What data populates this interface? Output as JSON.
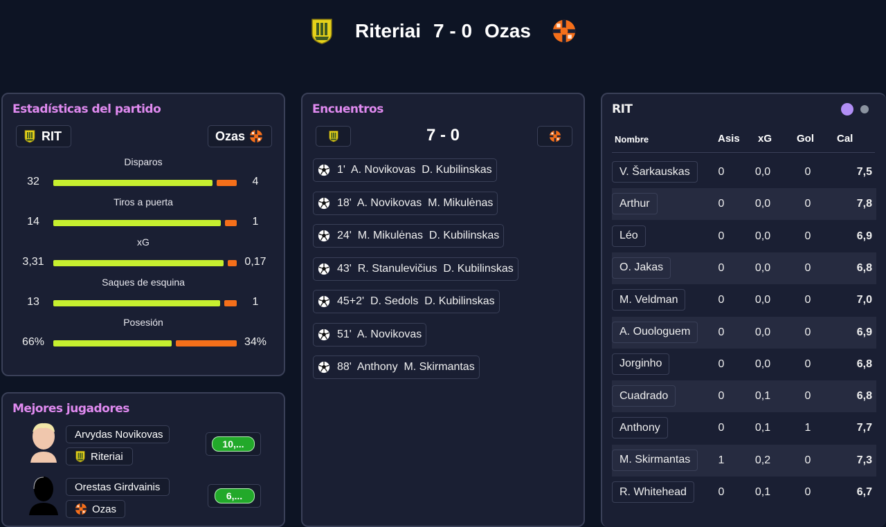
{
  "header": {
    "home": "Riteriai",
    "score": "7 - 0",
    "away": "Ozas"
  },
  "colors": {
    "accent": "#e08af0",
    "home_bar": "#c6ef2f",
    "away_bar": "#f56f1a",
    "rating_green": "#22a92a"
  },
  "stats_panel": {
    "title": "Estadísticas del partido",
    "home_short": "RIT",
    "away_short": "Ozas",
    "stats": [
      {
        "label": "Disparos",
        "home": "32",
        "away": "4",
        "home_value": 32,
        "away_value": 4
      },
      {
        "label": "Tiros a puerta",
        "home": "14",
        "away": "1",
        "home_value": 14,
        "away_value": 1
      },
      {
        "label": "xG",
        "home": "3,31",
        "away": "0,17",
        "home_value": 3.31,
        "away_value": 0.17
      },
      {
        "label": "Saques de esquina",
        "home": "13",
        "away": "1",
        "home_value": 13,
        "away_value": 1
      },
      {
        "label": "Posesión",
        "home": "66%",
        "away": "34%",
        "home_value": 66,
        "away_value": 34
      }
    ]
  },
  "best_players": {
    "title": "Mejores jugadores",
    "players": [
      {
        "name": "Arvydas Novikovas",
        "team": "Riteriai",
        "rating": "10,..."
      },
      {
        "name": "Orestas Girdvainis",
        "team": "Ozas",
        "rating": "6,..."
      }
    ]
  },
  "events_panel": {
    "title": "Encuentros",
    "score": "7 - 0",
    "events": [
      "1'  A. Novikovas  D. Kubilinskas",
      "18'  A. Novikovas  M. Mikulėnas",
      "24'  M. Mikulėnas  D. Kubilinskas",
      "43'  R. Stanulevičius  D. Kubilinskas",
      "45+2'  D. Sedols  D. Kubilinskas",
      "51'  A. Novikovas",
      "88'  Anthony  M. Skirmantas"
    ]
  },
  "lineup_panel": {
    "team": "RIT",
    "columns": [
      "Nombre",
      "Asis",
      "xG",
      "Gol",
      "Cal"
    ],
    "rows": [
      {
        "name": "V. Šarkauskas",
        "asis": "0",
        "xg": "0,0",
        "gol": "0",
        "cal": "7,5"
      },
      {
        "name": "Arthur",
        "asis": "0",
        "xg": "0,0",
        "gol": "0",
        "cal": "7,8"
      },
      {
        "name": "Léo",
        "asis": "0",
        "xg": "0,0",
        "gol": "0",
        "cal": "6,9"
      },
      {
        "name": "O. Jakas",
        "asis": "0",
        "xg": "0,0",
        "gol": "0",
        "cal": "6,8"
      },
      {
        "name": "M. Veldman",
        "asis": "0",
        "xg": "0,0",
        "gol": "0",
        "cal": "7,0"
      },
      {
        "name": "A. Ouologuem",
        "asis": "0",
        "xg": "0,0",
        "gol": "0",
        "cal": "6,9"
      },
      {
        "name": "Jorginho",
        "asis": "0",
        "xg": "0,0",
        "gol": "0",
        "cal": "6,8"
      },
      {
        "name": "Cuadrado",
        "asis": "0",
        "xg": "0,1",
        "gol": "0",
        "cal": "6,8"
      },
      {
        "name": "Anthony",
        "asis": "0",
        "xg": "0,1",
        "gol": "1",
        "cal": "7,7"
      },
      {
        "name": "M. Skirmantas",
        "asis": "1",
        "xg": "0,2",
        "gol": "0",
        "cal": "7,3"
      },
      {
        "name": "R. Whitehead",
        "asis": "0",
        "xg": "0,1",
        "gol": "0",
        "cal": "6,7"
      }
    ]
  }
}
